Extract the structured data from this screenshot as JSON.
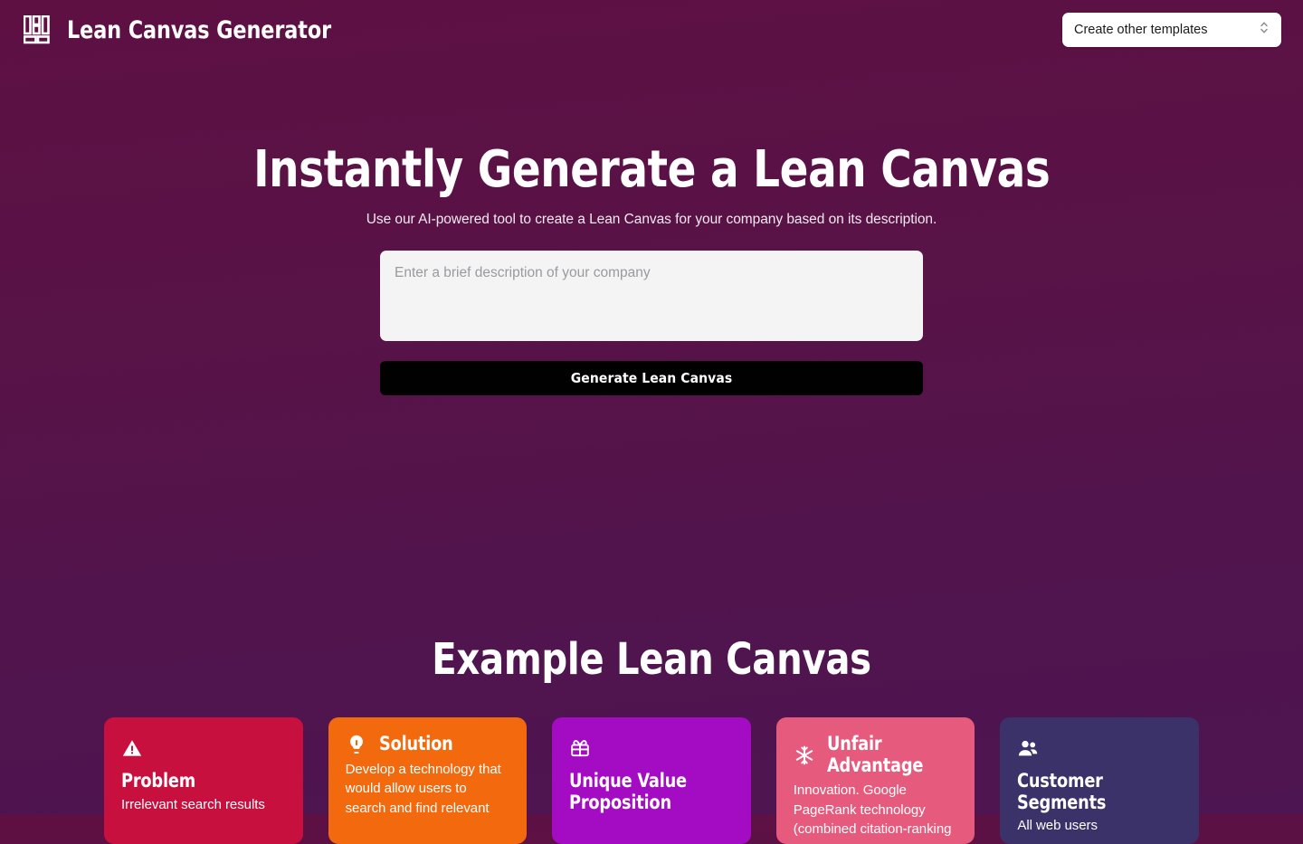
{
  "header": {
    "logo_icon": "lean-canvas-grid-icon",
    "brand_title": "Lean Canvas Generator",
    "template_select": {
      "selected": "Create other templates",
      "chevron_icon": "chevron-up-down-icon",
      "options": [
        "Create other templates"
      ]
    }
  },
  "hero": {
    "title": "Instantly Generate a Lean Canvas",
    "subtitle": "Use our AI-powered tool to create a Lean Canvas for your company based on its description.",
    "input_placeholder": "Enter a brief description of your company",
    "input_value": "",
    "generate_button": "Generate Lean Canvas"
  },
  "example": {
    "heading": "Example Lean Canvas",
    "cards": [
      {
        "icon": "warning-triangle-icon",
        "title": "Problem",
        "body": "Irrelevant search results",
        "color": "#c8103f",
        "layout": "stacked"
      },
      {
        "icon": "lightbulb-icon",
        "title": "Solution",
        "body": "Develop a technology that would allow users to search and find relevant",
        "color": "#f2690e",
        "layout": "inline"
      },
      {
        "icon": "gift-icon",
        "title": "Unique Value Proposition",
        "body": "",
        "color": "#a30cc2",
        "layout": "stacked"
      },
      {
        "icon": "sparkle-icon",
        "title": "Unfair Advantage",
        "body": "Innovation. Google PageRank technology (combined citation-ranking",
        "color": "#e65a7d",
        "layout": "inline"
      },
      {
        "icon": "people-icon",
        "title": "Customer Segments",
        "body": "All web users",
        "color": "#3b3269",
        "layout": "stacked"
      }
    ]
  }
}
